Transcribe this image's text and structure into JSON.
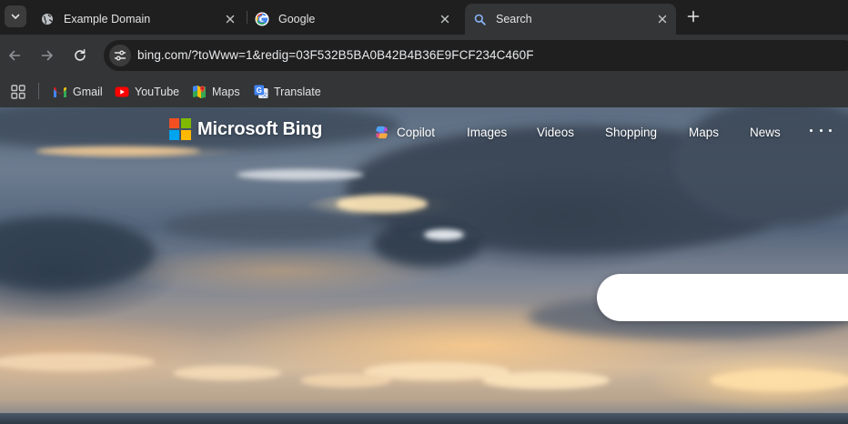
{
  "tabs": [
    {
      "title": "Example Domain",
      "favicon": "globe-icon",
      "active": false
    },
    {
      "title": "Google",
      "favicon": "google-g-icon",
      "active": false
    },
    {
      "title": "Search",
      "favicon": "search-icon",
      "active": true
    }
  ],
  "toolbar": {
    "url": "bing.com/?toWww=1&redig=03F532B5BA0B42B4B36E9FCF234C460F"
  },
  "bookmarks": [
    {
      "label": "Gmail",
      "icon": "gmail-icon"
    },
    {
      "label": "YouTube",
      "icon": "youtube-icon"
    },
    {
      "label": "Maps",
      "icon": "maps-icon"
    },
    {
      "label": "Translate",
      "icon": "translate-icon"
    }
  ],
  "bing": {
    "logo_text": "Microsoft Bing",
    "nav": [
      "Copilot",
      "Images",
      "Videos",
      "Shopping",
      "Maps",
      "News"
    ],
    "search_placeholder": ""
  },
  "colors": {
    "tabstrip": "#1f1f1f",
    "toolbar": "#333536",
    "omnibox": "#1f1f1f",
    "ms_red": "#f25022",
    "ms_green": "#7fba00",
    "ms_blue": "#00a4ef",
    "ms_yellow": "#ffb900"
  }
}
